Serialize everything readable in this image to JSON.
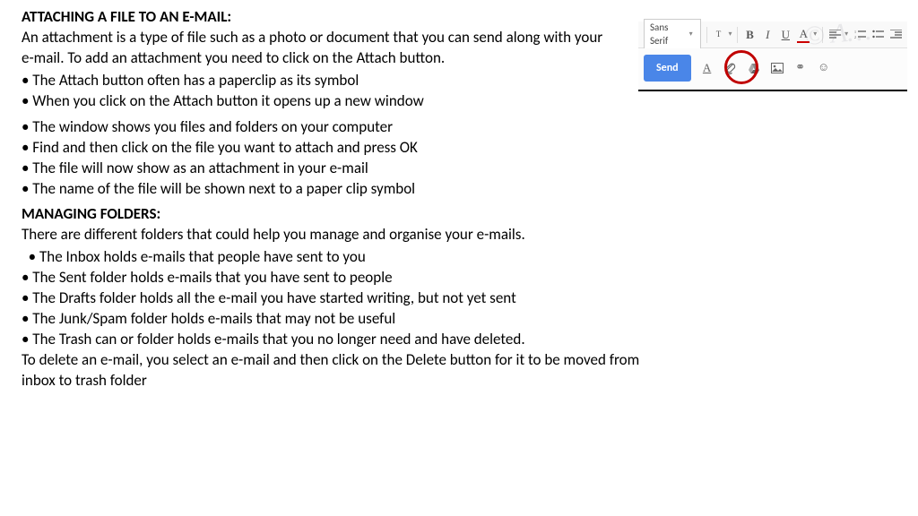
{
  "section1": {
    "heading": "ATTACHING A FILE TO AN E-MAIL:",
    "intro": " An attachment is a type of file such as a photo or document that you can send along with your e-mail. To add an attachment you need to click on the Attach button.",
    "bulletsA": [
      "• The Attach button often has a paperclip as its symbol",
      "• When you click on the Attach button it opens up a new window"
    ],
    "bulletsB": [
      "• The window shows you files and folders on your computer",
      "• Find and then click on the file you want to attach and press OK",
      "• The file will now show as an attachment in your e-mail",
      "• The name of the file will be shown next to a paper clip symbol"
    ]
  },
  "section2": {
    "heading": "MANAGING FOLDERS:",
    "intro": "There are different folders that could help you manage and organise your e-mails.",
    "bullets": [
      "  • The Inbox holds e-mails that people have sent to you",
      "• The Sent folder holds e-mails that you have sent to people",
      "• The Drafts folder holds all the e-mail you have started writing, but not yet sent",
      "• The Junk/Spam folder holds e-mails that may not be useful",
      "• The Trash can or folder holds e-mails that you no longer need and have deleted."
    ],
    "outro": "To delete an e-mail, you select an e-mail and then click on the Delete button for it to be moved from inbox to trash folder"
  },
  "toolbar": {
    "font": "Sans Serif",
    "size_label": "T",
    "bold": "B",
    "italic": "I",
    "underline": "U",
    "textcolor": "A",
    "send": "Send",
    "link": "⚭",
    "emoji": "☺"
  }
}
